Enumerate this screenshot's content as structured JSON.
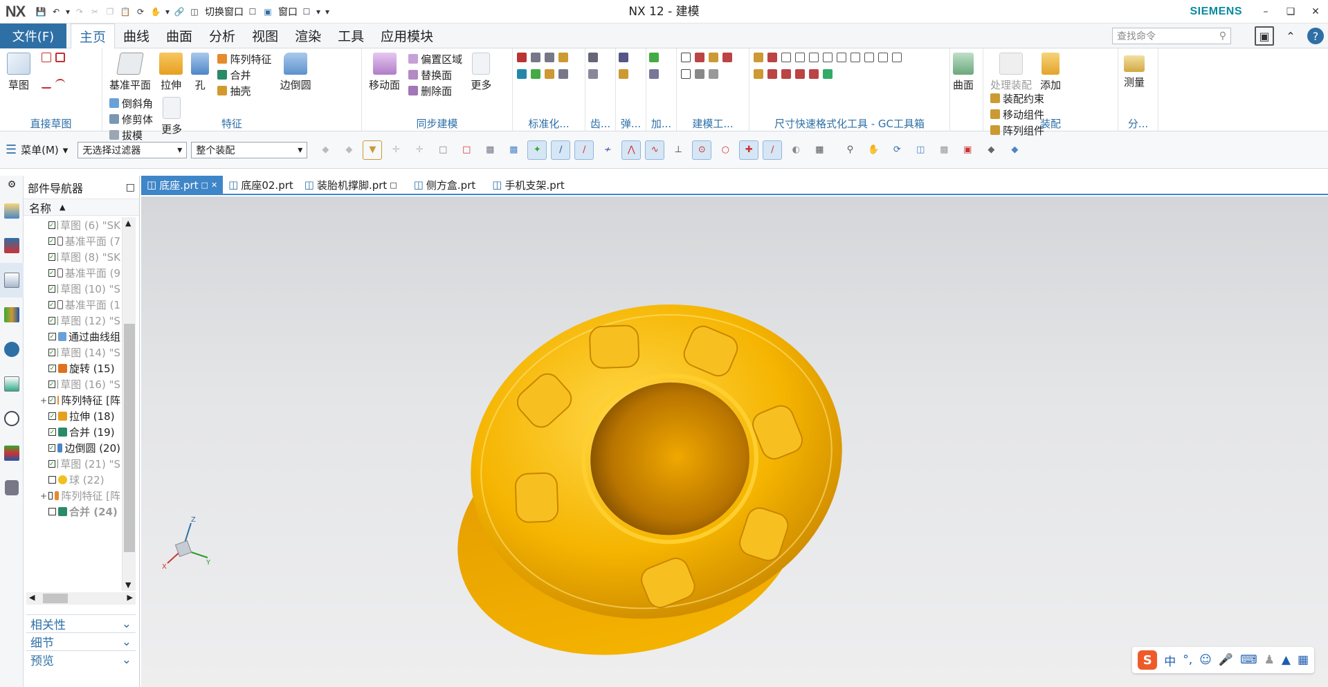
{
  "app": {
    "logo": "NX",
    "window_title": "NX 12 - 建模",
    "brand": "SIEMENS",
    "quick_access": {
      "switch_window": "切换窗口",
      "window": "窗口"
    }
  },
  "menubar": {
    "file": "文件(F)",
    "tabs": [
      "主页",
      "曲线",
      "曲面",
      "分析",
      "视图",
      "渲染",
      "工具",
      "应用模块"
    ],
    "search_placeholder": "查找命令"
  },
  "ribbon": {
    "direct_sketch": {
      "sketch": "草图",
      "label": "直接草图"
    },
    "feature": {
      "datum_plane": "基准平面",
      "extrude": "拉伸",
      "hole": "孔",
      "pattern_feature": "阵列特征",
      "unite": "合并",
      "shell": "抽壳",
      "edge_blend": "边倒圆",
      "chamfer": "倒斜角",
      "trim_body": "修剪体",
      "draft": "拔模",
      "more": "更多",
      "label": "特征"
    },
    "sync": {
      "move_face": "移动面",
      "offset_region": "偏置区域",
      "replace_face": "替换面",
      "delete_face": "删除面",
      "more": "更多",
      "label": "同步建模"
    },
    "std": {
      "label": "标准化..."
    },
    "gear": {
      "label": "齿..."
    },
    "spring": {
      "label": "弹..."
    },
    "add": {
      "label": "加..."
    },
    "modeling_tools": {
      "label": "建模工..."
    },
    "gc": {
      "label": "尺寸快速格式化工具 - GC工具箱"
    },
    "surface": {
      "label": "曲面"
    },
    "assembly": {
      "process_assembly": "处理装配",
      "add": "添加",
      "assembly_constraint": "装配约束",
      "move_component": "移动组件",
      "pattern_component": "阵列组件",
      "label": "装配"
    },
    "measure": {
      "label": "测量"
    },
    "analysis": {
      "label": "分..."
    }
  },
  "toolbar2": {
    "menu": "菜单(M)",
    "filter": "无选择过滤器",
    "scope": "整个装配"
  },
  "navigator": {
    "title": "部件导航器",
    "column": "名称",
    "nodes": [
      {
        "label": "草图 (6) \"SK",
        "checked": true,
        "style": "dim",
        "icon": "sketch",
        "plus": false
      },
      {
        "label": "基准平面 (7",
        "checked": true,
        "style": "dim",
        "icon": "plane",
        "plus": false
      },
      {
        "label": "草图 (8) \"SK",
        "checked": true,
        "style": "dim",
        "icon": "sketch",
        "plus": false
      },
      {
        "label": "基准平面 (9",
        "checked": true,
        "style": "dim",
        "icon": "plane",
        "plus": false
      },
      {
        "label": "草图 (10) \"S",
        "checked": true,
        "style": "dim",
        "icon": "sketch",
        "plus": false
      },
      {
        "label": "基准平面 (1",
        "checked": true,
        "style": "dim",
        "icon": "plane",
        "plus": false
      },
      {
        "label": "草图 (12) \"S",
        "checked": true,
        "style": "dim",
        "icon": "sketch",
        "plus": false
      },
      {
        "label": "通过曲线组",
        "checked": true,
        "style": "ok",
        "icon": "surface",
        "plus": false
      },
      {
        "label": "草图 (14) \"S",
        "checked": true,
        "style": "dim",
        "icon": "sketch",
        "plus": false
      },
      {
        "label": "旋转 (15)",
        "checked": true,
        "style": "ok",
        "icon": "revolve",
        "plus": false
      },
      {
        "label": "草图 (16) \"S",
        "checked": true,
        "style": "dim",
        "icon": "sketch",
        "plus": false
      },
      {
        "label": "阵列特征 [阵",
        "checked": true,
        "style": "ok",
        "icon": "pattern",
        "plus": true
      },
      {
        "label": "拉伸 (18)",
        "checked": true,
        "style": "ok",
        "icon": "extrude",
        "plus": false
      },
      {
        "label": "合并 (19)",
        "checked": true,
        "style": "ok",
        "icon": "unite",
        "plus": false
      },
      {
        "label": "边倒圆 (20)",
        "checked": true,
        "style": "ok",
        "icon": "blend",
        "plus": false
      },
      {
        "label": "草图 (21) \"S",
        "checked": true,
        "style": "dim",
        "icon": "sketch",
        "plus": false
      },
      {
        "label": "球 (22)",
        "checked": false,
        "style": "dim",
        "icon": "sphere",
        "plus": false
      },
      {
        "label": "阵列特征 [阵",
        "checked": false,
        "style": "dim",
        "icon": "pattern",
        "plus": true
      },
      {
        "label": "合并 (24)",
        "checked": false,
        "style": "bold",
        "icon": "unite",
        "plus": false
      }
    ],
    "panels": [
      "相关性",
      "细节",
      "预览"
    ]
  },
  "doc_tabs": [
    "底座.prt",
    "底座02.prt",
    "装胎机撑脚.prt",
    "侧方盒.prt",
    "手机支架.prt"
  ],
  "ime": {
    "logo": "S",
    "mode": "中",
    "punct": "°,"
  },
  "colors": {
    "accent": "#2e6fa6",
    "active_tab": "#3f86c8",
    "part": "#f5b400",
    "brand": "#0a8aa0"
  }
}
